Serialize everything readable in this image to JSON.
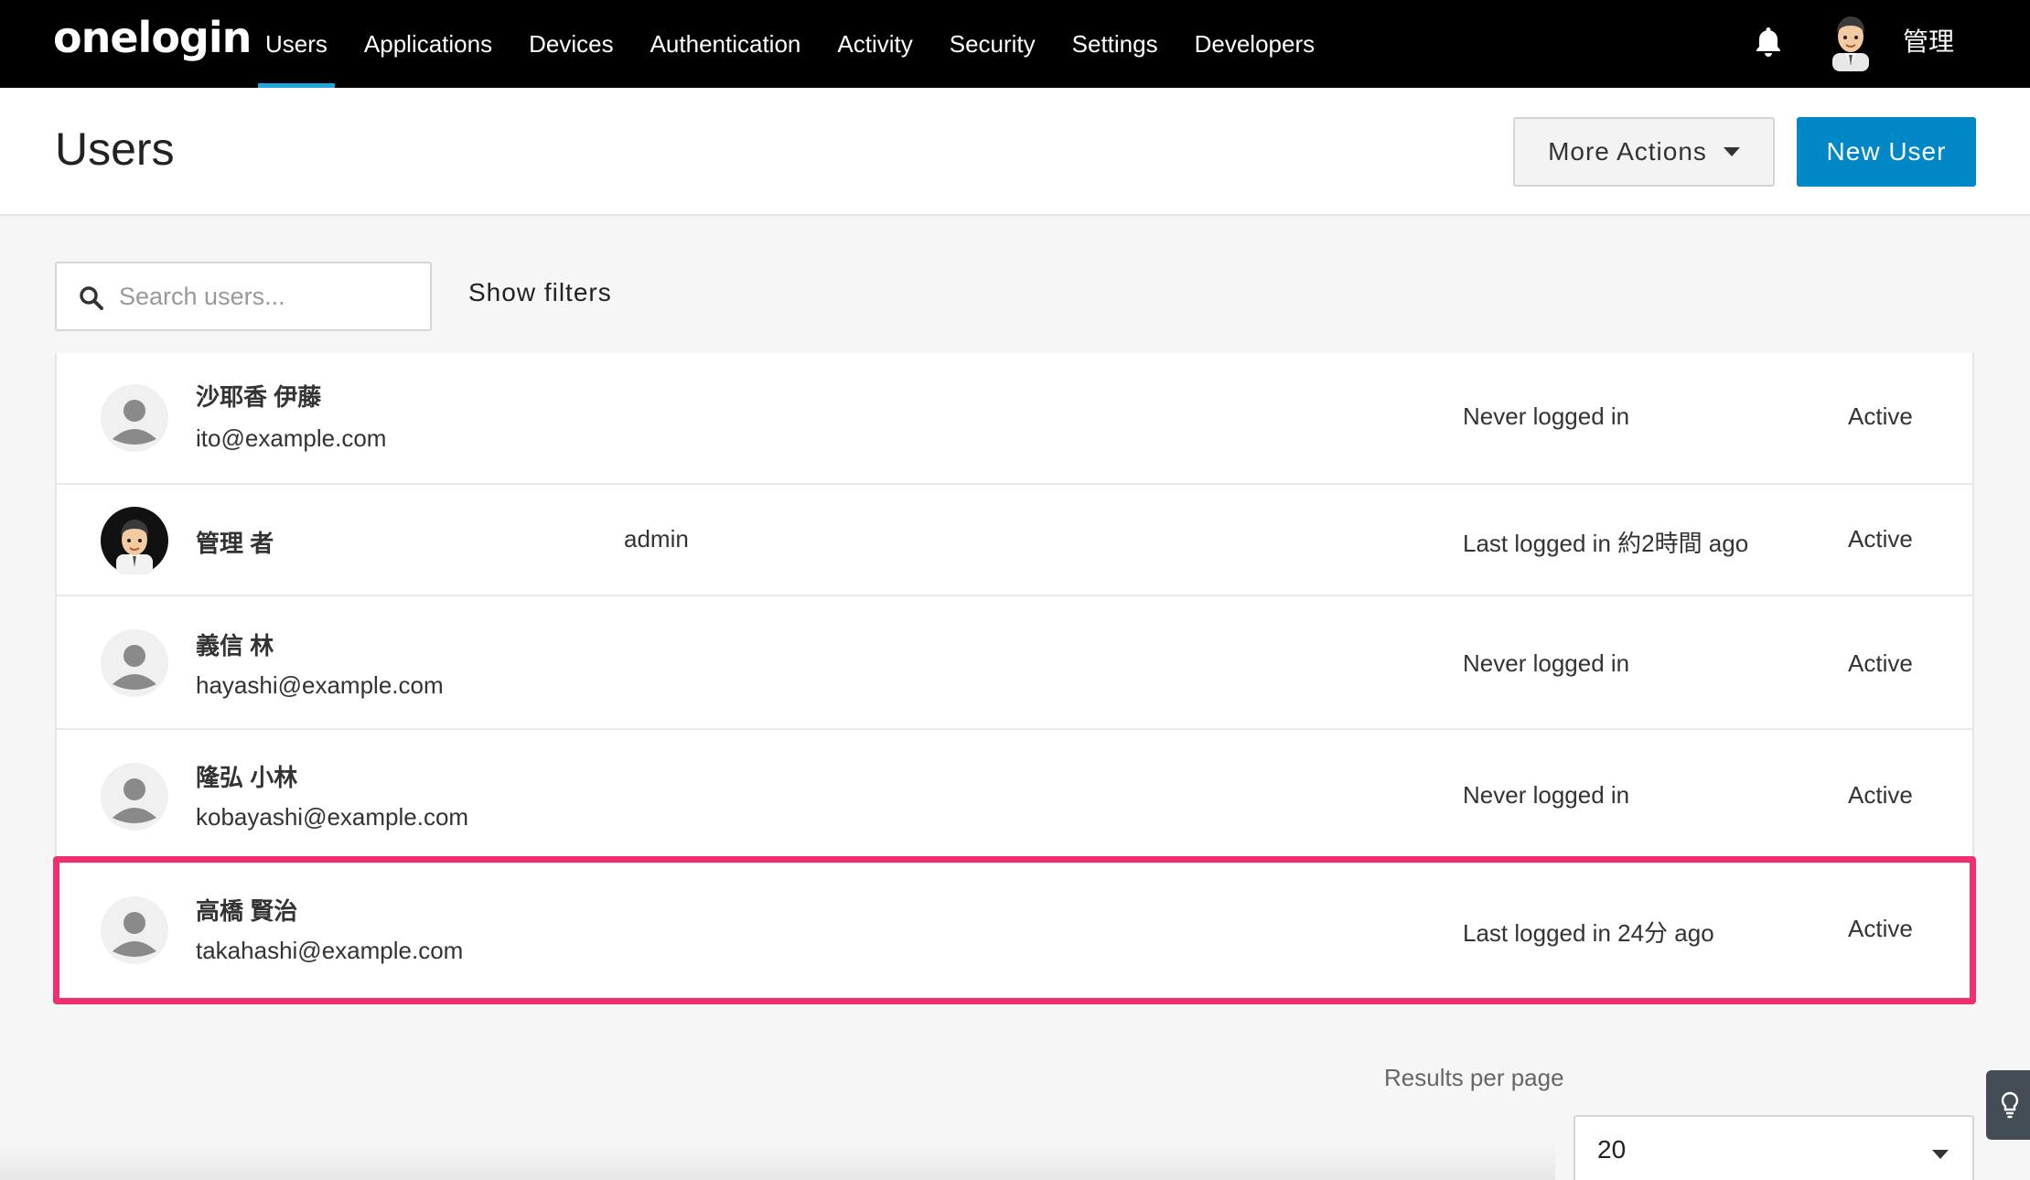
{
  "app": {
    "logo": "onelogin"
  },
  "nav": {
    "items": [
      {
        "label": "Users",
        "active": true
      },
      {
        "label": "Applications"
      },
      {
        "label": "Devices"
      },
      {
        "label": "Authentication"
      },
      {
        "label": "Activity"
      },
      {
        "label": "Security"
      },
      {
        "label": "Settings"
      },
      {
        "label": "Developers"
      }
    ],
    "notifications_icon": "bell-icon",
    "user_name": "管理"
  },
  "header": {
    "title": "Users",
    "more_actions_label": "More Actions",
    "new_user_label": "New User"
  },
  "search": {
    "placeholder": "Search users...",
    "value": "",
    "show_filters_label": "Show filters"
  },
  "users": [
    {
      "name": "沙耶香 伊藤",
      "email": "ito@example.com",
      "username": "",
      "login": "Never logged in",
      "status": "Active",
      "avatar": "default"
    },
    {
      "name": "管理 者",
      "email": "",
      "username": "admin",
      "login": "Last logged in 約2時間 ago",
      "status": "Active",
      "avatar": "photo"
    },
    {
      "name": "義信 林",
      "email": "hayashi@example.com",
      "username": "",
      "login": "Never logged in",
      "status": "Active",
      "avatar": "default"
    },
    {
      "name": "隆弘 小林",
      "email": "kobayashi@example.com",
      "username": "",
      "login": "Never logged in",
      "status": "Active",
      "avatar": "default"
    },
    {
      "name": "高橋 賢治",
      "email": "takahashi@example.com",
      "username": "",
      "login": "Last logged in 24分 ago",
      "status": "Active",
      "avatar": "default",
      "highlighted": true
    }
  ],
  "pagination": {
    "results_per_page_label": "Results per page",
    "results_per_page_value": "20"
  },
  "colors": {
    "topbar": "#000000",
    "accent": "#0088c6",
    "nav_active_underline": "#1fa4e0",
    "highlight_border": "#f0306e"
  }
}
